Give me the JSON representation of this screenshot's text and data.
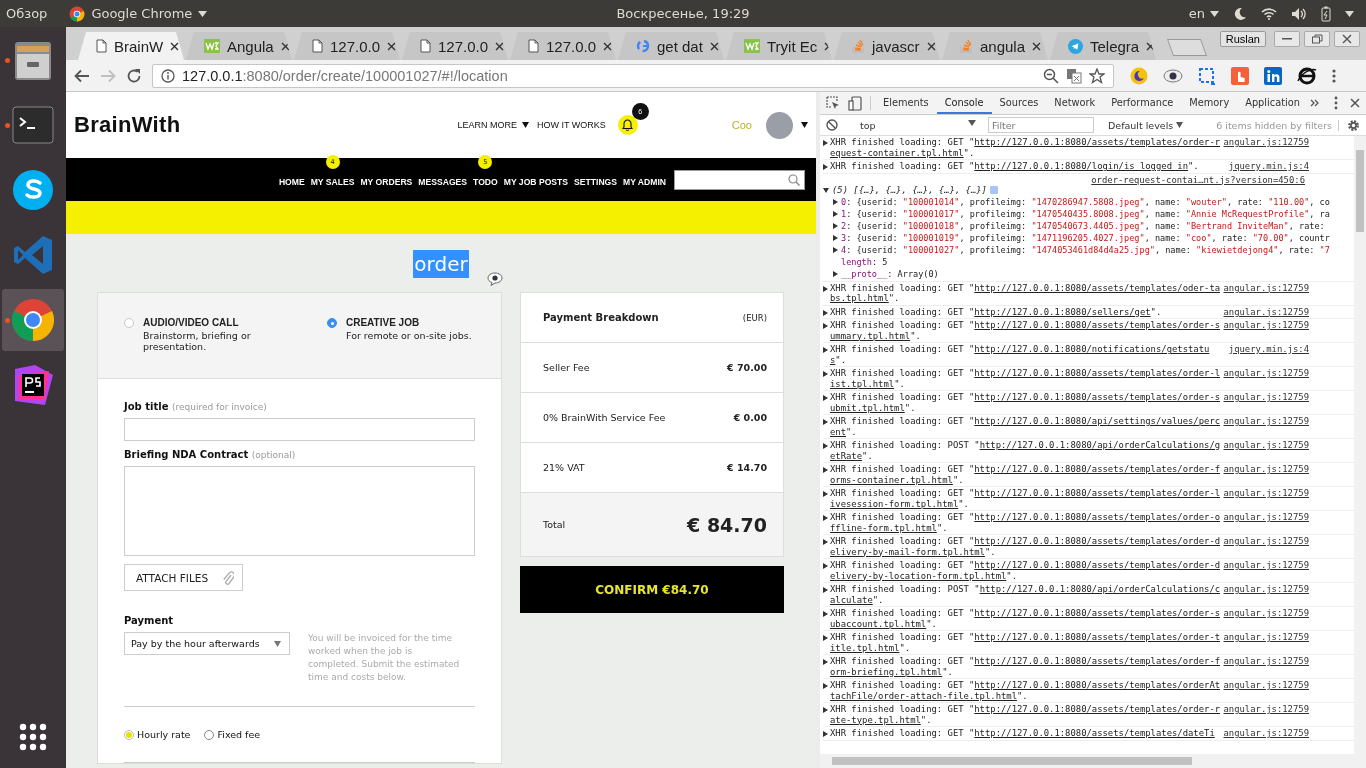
{
  "desktop": {
    "activities": "Обзор",
    "app_menu": "Google Chrome",
    "clock": "Воскресенье, 19:29",
    "keyboard_layout": "en"
  },
  "dock": [
    {
      "kind": "files",
      "running": true,
      "selected": false
    },
    {
      "kind": "terminal",
      "running": true,
      "selected": false
    },
    {
      "kind": "skype",
      "running": false,
      "selected": false
    },
    {
      "kind": "vscode",
      "running": false,
      "selected": false
    },
    {
      "kind": "chrome",
      "running": true,
      "selected": true
    },
    {
      "kind": "phpstorm",
      "running": false,
      "selected": false
    }
  ],
  "browser": {
    "tabs": [
      {
        "title": "BrainW",
        "kind": "page",
        "selected": true
      },
      {
        "title": "Angula",
        "kind": "w3",
        "selected": false
      },
      {
        "title": "127.0.0",
        "kind": "page",
        "selected": false
      },
      {
        "title": "127.0.0",
        "kind": "page",
        "selected": false
      },
      {
        "title": "127.0.0",
        "kind": "page",
        "selected": false
      },
      {
        "title": "get dat",
        "kind": "google",
        "selected": false
      },
      {
        "title": "Tryit Ec",
        "kind": "w3",
        "selected": false
      },
      {
        "title": "javascr",
        "kind": "stack",
        "selected": false
      },
      {
        "title": "angula",
        "kind": "stack",
        "selected": false
      },
      {
        "title": "Telegra",
        "kind": "telegram",
        "selected": false
      }
    ],
    "profile": "Ruslan",
    "address": {
      "host": "127.0.0.1",
      "path": ":8080/order/create/100001027/#!/location"
    }
  },
  "page": {
    "logo": "BrainWith",
    "header_links": [
      {
        "label": "LEARN MORE",
        "dropdown": true
      },
      {
        "label": "HOW IT WORKS",
        "dropdown": false
      }
    ],
    "notifications": "6",
    "user": "Coo",
    "nav": [
      {
        "label": "HOME"
      },
      {
        "label": "MY SALES",
        "badge": "4"
      },
      {
        "label": "MY ORDERS"
      },
      {
        "label": "MESSAGES"
      },
      {
        "label": "TODO",
        "badge": "5"
      },
      {
        "label": "MY JOB POSTS"
      },
      {
        "label": "SETTINGS"
      },
      {
        "label": "MY ADMIN"
      }
    ],
    "title": "order",
    "order_types": [
      {
        "title": "AUDIO/VIDEO CALL",
        "description": "Brainstorm, briefing or presentation.",
        "selected": false
      },
      {
        "title": "CREATIVE JOB",
        "description": "For remote or on-site jobs.",
        "selected": true
      }
    ],
    "job_title": {
      "label": "Job title",
      "hint": "(required for invoice)"
    },
    "briefing": {
      "label": "Briefing NDA Contract",
      "hint": "(optional)"
    },
    "attach_button": "ATTACH FILES",
    "payment": {
      "label": "Payment",
      "value": "Pay by the hour afterwards",
      "help": "You will be invoiced for the time worked when the job is completed. Submit the estimated time and costs below."
    },
    "rate_types": [
      {
        "label": "Hourly rate",
        "selected": true
      },
      {
        "label": "Fixed fee",
        "selected": false
      }
    ],
    "breakdown": {
      "title": "Payment Breakdown",
      "currency": "(EUR)",
      "rows": [
        {
          "label": "Seller Fee",
          "amount": "€ 70.00"
        },
        {
          "label": "0% BrainWith Service Fee",
          "amount": "€ 0.00"
        },
        {
          "label": "21% VAT",
          "amount": "€ 14.70"
        }
      ],
      "total_label": "Total",
      "total": "€ 84.70"
    },
    "confirm_button": "CONFIRM €84.70"
  },
  "devtools": {
    "tabs": [
      {
        "label": "Elements",
        "selected": false
      },
      {
        "label": "Console",
        "selected": true
      },
      {
        "label": "Sources",
        "selected": false
      },
      {
        "label": "Network",
        "selected": false
      },
      {
        "label": "Performance",
        "selected": false
      },
      {
        "label": "Memory",
        "selected": false
      },
      {
        "label": "Application",
        "selected": false
      }
    ],
    "context": "top",
    "filter_placeholder": "Filter",
    "levels": "Default levels",
    "hidden_note": "6 items hidden by filters",
    "messages": [
      {
        "kind": "xhr",
        "prefix": "XHR finished loading: GET \"",
        "url": "http://127.0.0.1:8080/assets/templates/order-request-container.tpl.html",
        "suffix": "\".",
        "source": "angular.js:12759"
      },
      {
        "kind": "xhr",
        "prefix": "XHR finished loading: GET \"",
        "url": "http://127.0.0.1:8080/login/is_logged_in",
        "suffix": "\".",
        "source": "jquery.min.js:4"
      },
      {
        "kind": "group",
        "source": "order-request-contai…nt.js?version=450:6",
        "summary": "(5) [{…}, {…}, {…}, {…}, {…}]",
        "expanded": true,
        "items": [
          {
            "text": "0: {userid: \"100001014\", profileimg: \"1470286947.5808.jpeg\", name: \"wouter\", rate: \"110.00\", co",
            "expandable": true
          },
          {
            "text": "1: {userid: \"100001017\", profileimg: \"1470540435.8008.jpeg\", name: \"Annie McRequestProfile\", ra",
            "expandable": true
          },
          {
            "text": "2: {userid: \"100001018\", profileimg: \"1470540673.4405.jpeg\", name: \"Bertrand InviteMan\", rate:",
            "expandable": true
          },
          {
            "text": "3: {userid: \"100001019\", profileimg: \"1471196205.4027.jpeg\", name: \"coo\", rate: \"70.00\", countr",
            "expandable": true
          },
          {
            "text": "4: {userid: \"100001027\", profileimg: \"1474053461d84d4a25.jpg\", name: \"kiewietdejong4\", rate: \"7",
            "expandable": true
          },
          {
            "text": "length: 5",
            "expandable": false
          },
          {
            "text": "__proto__: Array(0)",
            "expandable": true
          }
        ]
      },
      {
        "kind": "xhr",
        "prefix": "XHR finished loading: GET \"",
        "url": "http://127.0.0.1:8080/assets/templates/oder-tabs.tpl.html",
        "suffix": "\".",
        "source": "angular.js:12759"
      },
      {
        "kind": "xhr",
        "prefix": "XHR finished loading: GET \"",
        "url": "http://127.0.0.1:8080/sellers/get",
        "suffix": "\".",
        "source": "angular.js:12759"
      },
      {
        "kind": "xhr",
        "prefix": "XHR finished loading: GET \"",
        "url": "http://127.0.0.1:8080/assets/templates/order-summary.tpl.html",
        "suffix": "\".",
        "source": "angular.js:12759"
      },
      {
        "kind": "xhr",
        "prefix": "XHR finished loading: GET \"",
        "url": "http://127.0.0.1:8080/notifications/getstatus",
        "suffix": "\".",
        "source": "jquery.min.js:4"
      },
      {
        "kind": "xhr",
        "prefix": "XHR finished loading: GET \"",
        "url": "http://127.0.0.1:8080/assets/templates/order-list.tpl.html",
        "suffix": "\".",
        "source": "angular.js:12759"
      },
      {
        "kind": "xhr",
        "prefix": "XHR finished loading: GET \"",
        "url": "http://127.0.0.1:8080/assets/templates/order-submit.tpl.html",
        "suffix": "\".",
        "source": "angular.js:12759"
      },
      {
        "kind": "xhr",
        "prefix": "XHR finished loading: GET \"",
        "url": "http://127.0.0.1:8080/api/settings/values/percent",
        "suffix": "\".",
        "source": "angular.js:12759"
      },
      {
        "kind": "xhr",
        "prefix": "XHR finished loading: POST \"",
        "url": "http://127.0.0.1:8080/api/orderCalculations/getRate",
        "suffix": "\".",
        "source": "angular.js:12759"
      },
      {
        "kind": "xhr",
        "prefix": "XHR finished loading: GET \"",
        "url": "http://127.0.0.1:8080/assets/templates/order-forms-container.tpl.html",
        "suffix": "\".",
        "source": "angular.js:12759"
      },
      {
        "kind": "xhr",
        "prefix": "XHR finished loading: GET \"",
        "url": "http://127.0.0.1:8080/assets/templates/order-livesession-form.tpl.html",
        "suffix": "\".",
        "source": "angular.js:12759"
      },
      {
        "kind": "xhr",
        "prefix": "XHR finished loading: GET \"",
        "url": "http://127.0.0.1:8080/assets/templates/order-offline-form.tpl.html",
        "suffix": "\".",
        "source": "angular.js:12759"
      },
      {
        "kind": "xhr",
        "prefix": "XHR finished loading: GET \"",
        "url": "http://127.0.0.1:8080/assets/templates/order-delivery-by-mail-form.tpl.html",
        "suffix": "\".",
        "source": "angular.js:12759"
      },
      {
        "kind": "xhr",
        "prefix": "XHR finished loading: GET \"",
        "url": "http://127.0.0.1:8080/assets/templates/order-delivery-by-location-form.tpl.html",
        "suffix": "\".",
        "source": "angular.js:12759"
      },
      {
        "kind": "xhr",
        "prefix": "XHR finished loading: POST \"",
        "url": "http://127.0.0.1:8080/api/orderCalculations/calculate",
        "suffix": "\".",
        "source": "angular.js:12759"
      },
      {
        "kind": "xhr",
        "prefix": "XHR finished loading: GET \"",
        "url": "http://127.0.0.1:8080/assets/templates/order-subaccount.tpl.html",
        "suffix": "\".",
        "source": "angular.js:12759"
      },
      {
        "kind": "xhr",
        "prefix": "XHR finished loading: GET \"",
        "url": "http://127.0.0.1:8080/assets/templates/order-title.tpl.html",
        "suffix": "\".",
        "source": "angular.js:12759"
      },
      {
        "kind": "xhr",
        "prefix": "XHR finished loading: GET \"",
        "url": "http://127.0.0.1:8080/assets/templates/order-form-briefing.tpl.html",
        "suffix": "\".",
        "source": "angular.js:12759"
      },
      {
        "kind": "xhr",
        "prefix": "XHR finished loading: GET \"",
        "url": "http://127.0.0.1:8080/assets/templates/orderAttachFile/order-attach-file.tpl.html",
        "suffix": "\".",
        "source": "angular.js:12759"
      },
      {
        "kind": "xhr",
        "prefix": "XHR finished loading: GET \"",
        "url": "http://127.0.0.1:8080/assets/templates/order-rate-type.tpl.html",
        "suffix": "\".",
        "source": "angular.js:12759"
      },
      {
        "kind": "xhr",
        "prefix": "XHR finished loading: GET \"",
        "url": "http://127.0.0.1:8080/assets/templates/dateTi",
        "source": "angular.js:12759"
      }
    ]
  }
}
